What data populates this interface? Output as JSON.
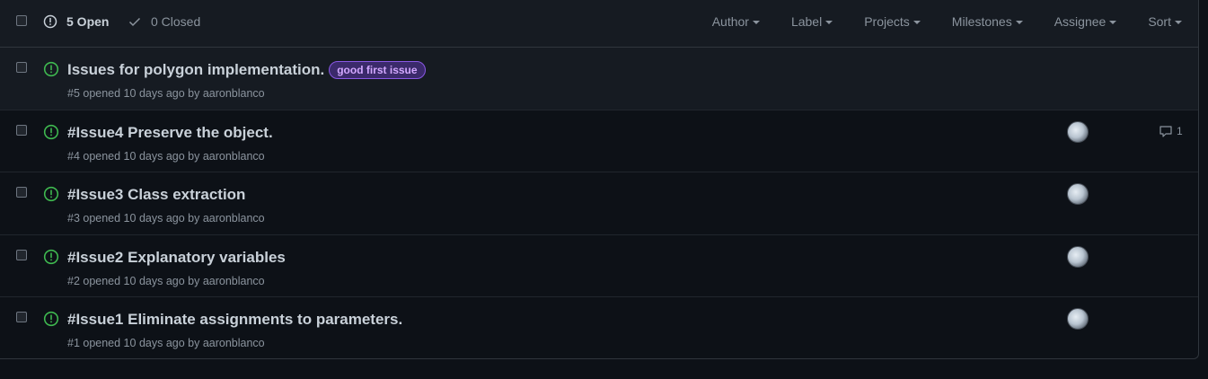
{
  "header": {
    "open_label": "5 Open",
    "closed_label": "0 Closed",
    "filters": [
      "Author",
      "Label",
      "Projects",
      "Milestones",
      "Assignee",
      "Sort"
    ]
  },
  "issues": [
    {
      "title": "Issues for polygon implementation.",
      "label": "good first issue",
      "meta": "#5 opened 10 days ago by aaronblanco",
      "comments": ""
    },
    {
      "title": "#Issue4 Preserve the object.",
      "meta": "#4 opened 10 days ago by aaronblanco",
      "comments": "1"
    },
    {
      "title": "#Issue3 Class extraction",
      "meta": "#3 opened 10 days ago by aaronblanco",
      "comments": ""
    },
    {
      "title": "#Issue2 Explanatory variables",
      "meta": "#2 opened 10 days ago by aaronblanco",
      "comments": ""
    },
    {
      "title": "#Issue1 Eliminate assignments to parameters.",
      "meta": "#1 opened 10 days ago by aaronblanco",
      "comments": ""
    }
  ],
  "colors": {
    "background": "#0d1117",
    "header_bg": "#161b22",
    "open_icon": "#3fb950",
    "label_text": "#d2a8ff",
    "label_border": "#8957e5",
    "muted_text": "#8b949e"
  },
  "icons": {
    "open": "issue-opened-icon",
    "closed": "check-icon",
    "comment": "comment-icon",
    "caret": "caret-down-icon"
  }
}
